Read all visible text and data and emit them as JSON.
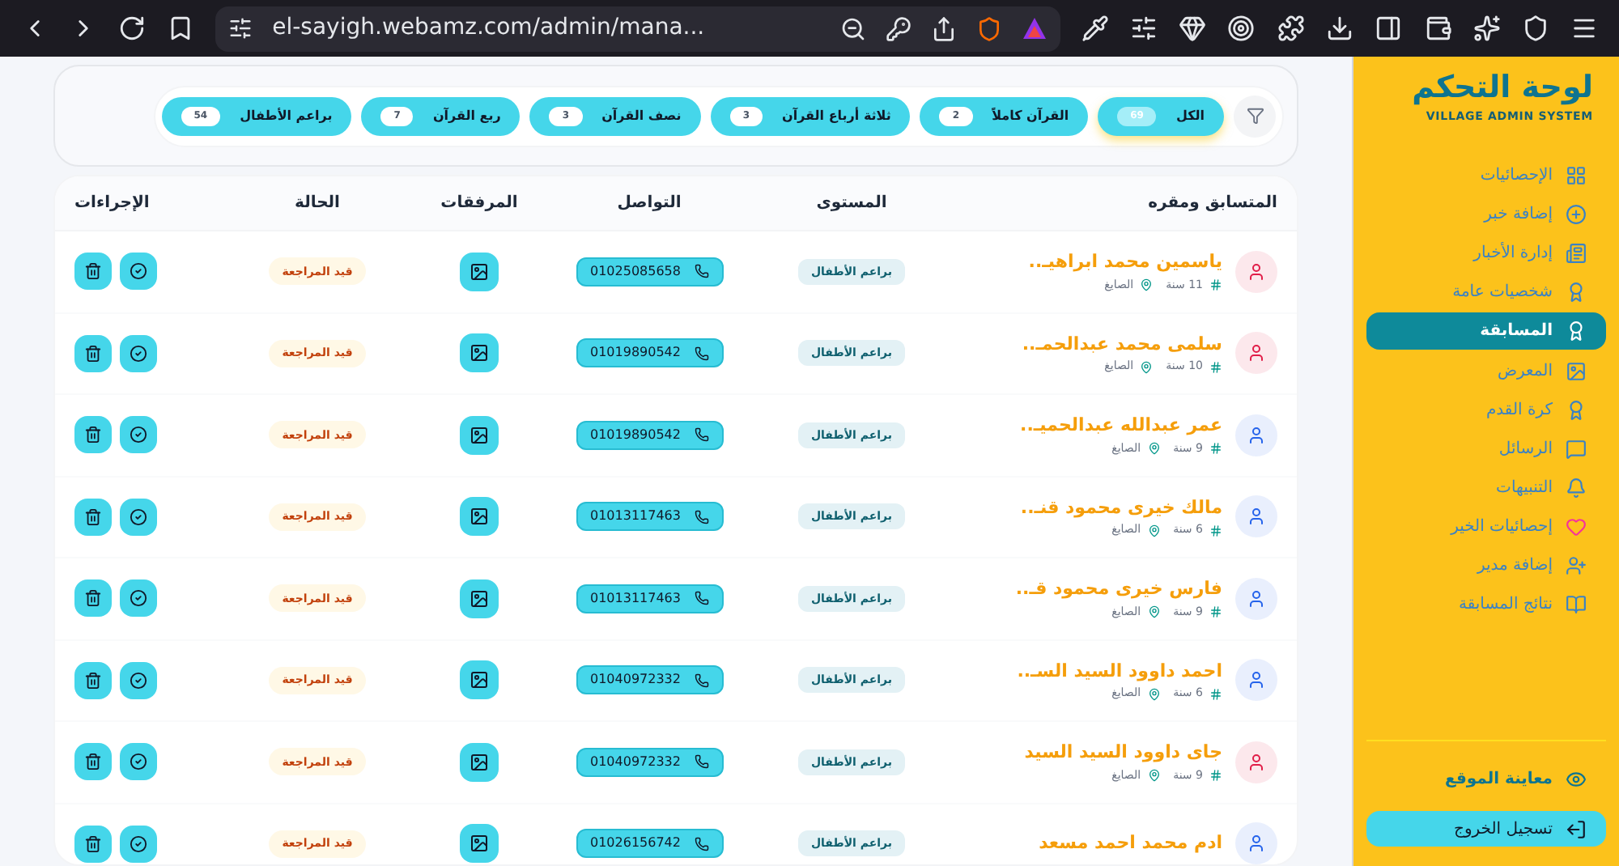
{
  "browser": {
    "url": "el-sayigh.webamz.com/admin/mana..."
  },
  "sidebar": {
    "title": "لوحة التحكم",
    "subtitle": "VILLAGE ADMIN SYSTEM",
    "items": [
      {
        "label": "الإحصائيات",
        "selected": false
      },
      {
        "label": "إضافة خبر",
        "selected": false
      },
      {
        "label": "إدارة الأخبار",
        "selected": false
      },
      {
        "label": "شخصيات عامة",
        "selected": false
      },
      {
        "label": "المسابقة",
        "selected": true
      },
      {
        "label": "المعرض",
        "selected": false
      },
      {
        "label": "كرة القدم",
        "selected": false
      },
      {
        "label": "الرسائل",
        "selected": false
      },
      {
        "label": "التنبيهات",
        "selected": false
      },
      {
        "label": "إحصائيات الخير",
        "selected": false
      },
      {
        "label": "إضافة مدير",
        "selected": false
      },
      {
        "label": "نتائج المسابقة",
        "selected": false
      }
    ],
    "preview": "معاينة الموقع",
    "logout": "تسجيل الخروج"
  },
  "filters": [
    {
      "label": "الكل",
      "count": "69",
      "selected": true
    },
    {
      "label": "القرآن كاملاً",
      "count": "2",
      "selected": false
    },
    {
      "label": "ثلاثة أرباع القرآن",
      "count": "3",
      "selected": false
    },
    {
      "label": "نصف القرآن",
      "count": "3",
      "selected": false
    },
    {
      "label": "ربع القرآن",
      "count": "7",
      "selected": false
    },
    {
      "label": "براعم الأطفال",
      "count": "54",
      "selected": false
    }
  ],
  "table": {
    "columns": [
      "المتسابق ومقره",
      "المستوى",
      "التواصل",
      "المرفقات",
      "الحالة",
      "الإجراءات"
    ],
    "rows": [
      {
        "name": "ياسمين محمد ابراهيـ..",
        "age": "11 سنة",
        "place": "الصايغ",
        "color": "#e11d48",
        "level": "براعم الأطفال",
        "phone": "01025085658",
        "status": "قيد المراجعة"
      },
      {
        "name": "سلمى محمد عبدالحمـ..",
        "age": "10 سنة",
        "place": "الصايغ",
        "color": "#e11d48",
        "level": "براعم الأطفال",
        "phone": "01019890542",
        "status": "قيد المراجعة"
      },
      {
        "name": "عمر عبدالله عبدالحميـ..",
        "age": "9 سنة",
        "place": "الصايغ",
        "color": "#2563eb",
        "level": "براعم الأطفال",
        "phone": "01019890542",
        "status": "قيد المراجعة"
      },
      {
        "name": "مالك خيرى محمود قنـ..",
        "age": "6 سنة",
        "place": "الصايغ",
        "color": "#2563eb",
        "level": "براعم الأطفال",
        "phone": "01013117463",
        "status": "قيد المراجعة"
      },
      {
        "name": "فارس خيرى محمود قـ..",
        "age": "9 سنة",
        "place": "الصايغ",
        "color": "#2563eb",
        "level": "براعم الأطفال",
        "phone": "01013117463",
        "status": "قيد المراجعة"
      },
      {
        "name": "احمد داوود السيد السـ..",
        "age": "6 سنة",
        "place": "الصايغ",
        "color": "#2563eb",
        "level": "براعم الأطفال",
        "phone": "01040972332",
        "status": "قيد المراجعة"
      },
      {
        "name": "جاى داوود السيد السيد",
        "age": "9 سنة",
        "place": "الصايغ",
        "color": "#e11d48",
        "level": "براعم الأطفال",
        "phone": "01040972332",
        "status": "قيد المراجعة"
      },
      {
        "name": "ادم محمد احمد مسعد",
        "color": "#2563eb",
        "level": "براعم الأطفال",
        "phone": "01026156742",
        "status": "قيد المراجعة"
      }
    ]
  }
}
